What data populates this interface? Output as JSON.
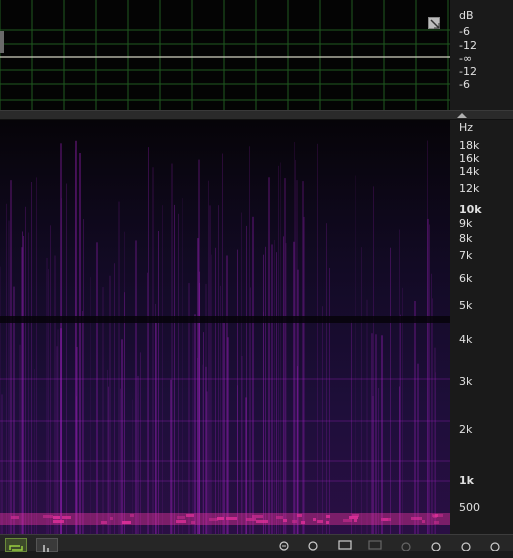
{
  "db_ruler": {
    "unit": "dB",
    "labels": [
      "-6",
      "-12",
      "-∞",
      "-12",
      "-6"
    ]
  },
  "hz_ruler": {
    "unit": "Hz",
    "labels": [
      "18k",
      "16k",
      "14k",
      "12k",
      "10k",
      "9k",
      "8k",
      "7k",
      "6k",
      "5k",
      "4k",
      "3k",
      "2k",
      "1k",
      "500"
    ]
  },
  "colors": {
    "grid": "#1f5a1f",
    "centerline": "#d0d0c0",
    "spectral_base": "#0a0610",
    "spectral_energy": "#a020c0",
    "spectral_hot": "#e0309a"
  },
  "toolbar": {
    "icons": [
      "loop-playback-icon",
      "meter-icon",
      "zoom-in-time-icon",
      "zoom-out-time-icon",
      "zoom-full-icon",
      "zoom-selection-icon",
      "zoom-in-amplitude-icon",
      "zoom-out-amplitude-icon",
      "zoom-in-frequency-icon"
    ]
  }
}
